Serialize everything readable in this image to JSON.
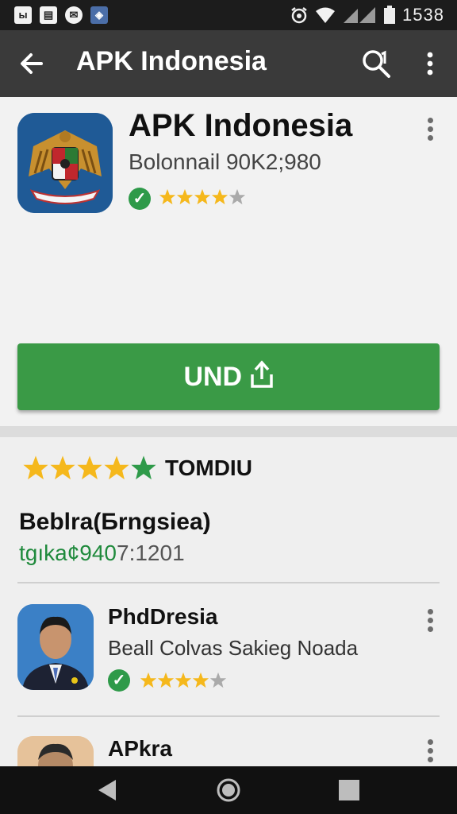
{
  "status_bar": {
    "time": "1538",
    "left_icons": [
      "photo-icon",
      "gallery-icon",
      "notification-icon",
      "shield-icon"
    ]
  },
  "app_bar": {
    "title": "APK Indonesia"
  },
  "app_header": {
    "name": "APK Indonesia",
    "subtitle": "Bolonnail 90K2;980",
    "rating_stars": 4
  },
  "install_button": {
    "label": "UND"
  },
  "rating_section": {
    "stars": 5,
    "label": "TOMDIU"
  },
  "section": {
    "title": "Beblra(Бrngsiea)",
    "meta_green": "tgıka¢940",
    "meta_gray": "7:1201"
  },
  "list": [
    {
      "name": "PhdDresia",
      "description": "Beall Colvas Sakieg Noada",
      "rating_stars": 4
    },
    {
      "name": "APkra"
    }
  ],
  "colors": {
    "accent_green": "#3a9a46",
    "star_yellow": "#f5b81c",
    "star_green": "#2e9a49",
    "app_bar": "#3a3a3a"
  }
}
